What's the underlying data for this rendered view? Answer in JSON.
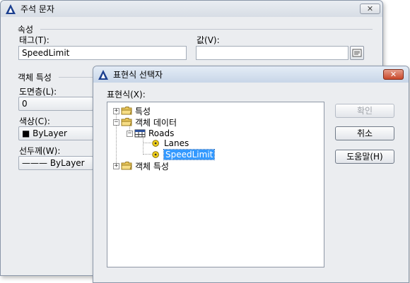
{
  "back_dialog": {
    "title": "주석 문자",
    "close": "✕",
    "section_properties": "속성",
    "tag_label": "태그(T):",
    "tag_value": "SpeedLimit",
    "value_label": "값(V):",
    "value_value": "",
    "section_object": "객체 특성",
    "layer_label": "도면층(L):",
    "layer_value": "0",
    "color_label": "색상(C):",
    "color_value": "■ ByLayer",
    "lineweight_label": "선두께(W):",
    "lineweight_value": "——— ByLayer"
  },
  "front_dialog": {
    "title": "표현식 선택자",
    "close": "✕",
    "expression_label": "표현식(X):",
    "tree": {
      "properties": "특성",
      "object_data": "객체 데이터",
      "roads": "Roads",
      "lanes": "Lanes",
      "speedlimit": "SpeedLimit",
      "object_props": "객체 특성"
    },
    "buttons": {
      "ok": "확인",
      "cancel": "취소",
      "help": "도움말(H)"
    }
  },
  "colors": {
    "selection": "#3399ff",
    "dialog_bg": "#ebedf0",
    "close_red": "#c9472a"
  }
}
